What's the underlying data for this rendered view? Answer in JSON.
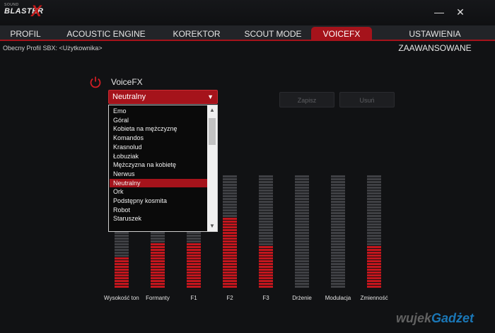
{
  "app": {
    "logo_small": "SOUND",
    "logo_main": "BLASTER",
    "logo_x": "X",
    "minimize_glyph": "—",
    "close_glyph": "✕"
  },
  "tabs": [
    {
      "label": "PROFIL",
      "active": false
    },
    {
      "label": "ACOUSTIC ENGINE",
      "active": false
    },
    {
      "label": "KOREKTOR",
      "active": false
    },
    {
      "label": "SCOUT MODE",
      "active": false
    },
    {
      "label": "VOICEFX",
      "active": true
    },
    {
      "label": "USTAWIENIA ZAAWANSOWANE",
      "active": false
    }
  ],
  "profile_line": "Obecny Profil SBX: <Użytkownika>",
  "voicefx": {
    "label": "VoiceFX",
    "power_icon": "power-icon",
    "selected": "Neutralny",
    "arrow": "▼"
  },
  "buttons": {
    "save": "Zapisz",
    "delete": "Usuń"
  },
  "dropdown": {
    "options": [
      "Emo",
      "Góral",
      "Kobieta na mężczyznę",
      "Komandos",
      "Krasnolud",
      "Łobuziak",
      "Mężczyzna na kobietę",
      "Nerwus",
      "Neutralny",
      "Ork",
      "Podstępny kosmita",
      "Robot",
      "Staruszek"
    ],
    "selected_index": 8,
    "scroll_up": "▲",
    "scroll_down": "▼"
  },
  "sliders": [
    {
      "label": "Wysokość tonu",
      "level": 0.27
    },
    {
      "label": "Formanty",
      "level": 0.4
    },
    {
      "label": "F1",
      "level": 0.4
    },
    {
      "label": "F2",
      "level": 0.62
    },
    {
      "label": "F3",
      "level": 0.38
    },
    {
      "label": "Drżenie",
      "level": 0.0
    },
    {
      "label": "Modulacja",
      "level": 0.0
    },
    {
      "label": "Zmienność",
      "level": 0.37
    }
  ],
  "colors": {
    "accent": "#a5131b",
    "background": "#111214",
    "segment_off": "#3f4044"
  },
  "watermark": {
    "prefix": "wujek",
    "suffix": "Gadżet"
  }
}
